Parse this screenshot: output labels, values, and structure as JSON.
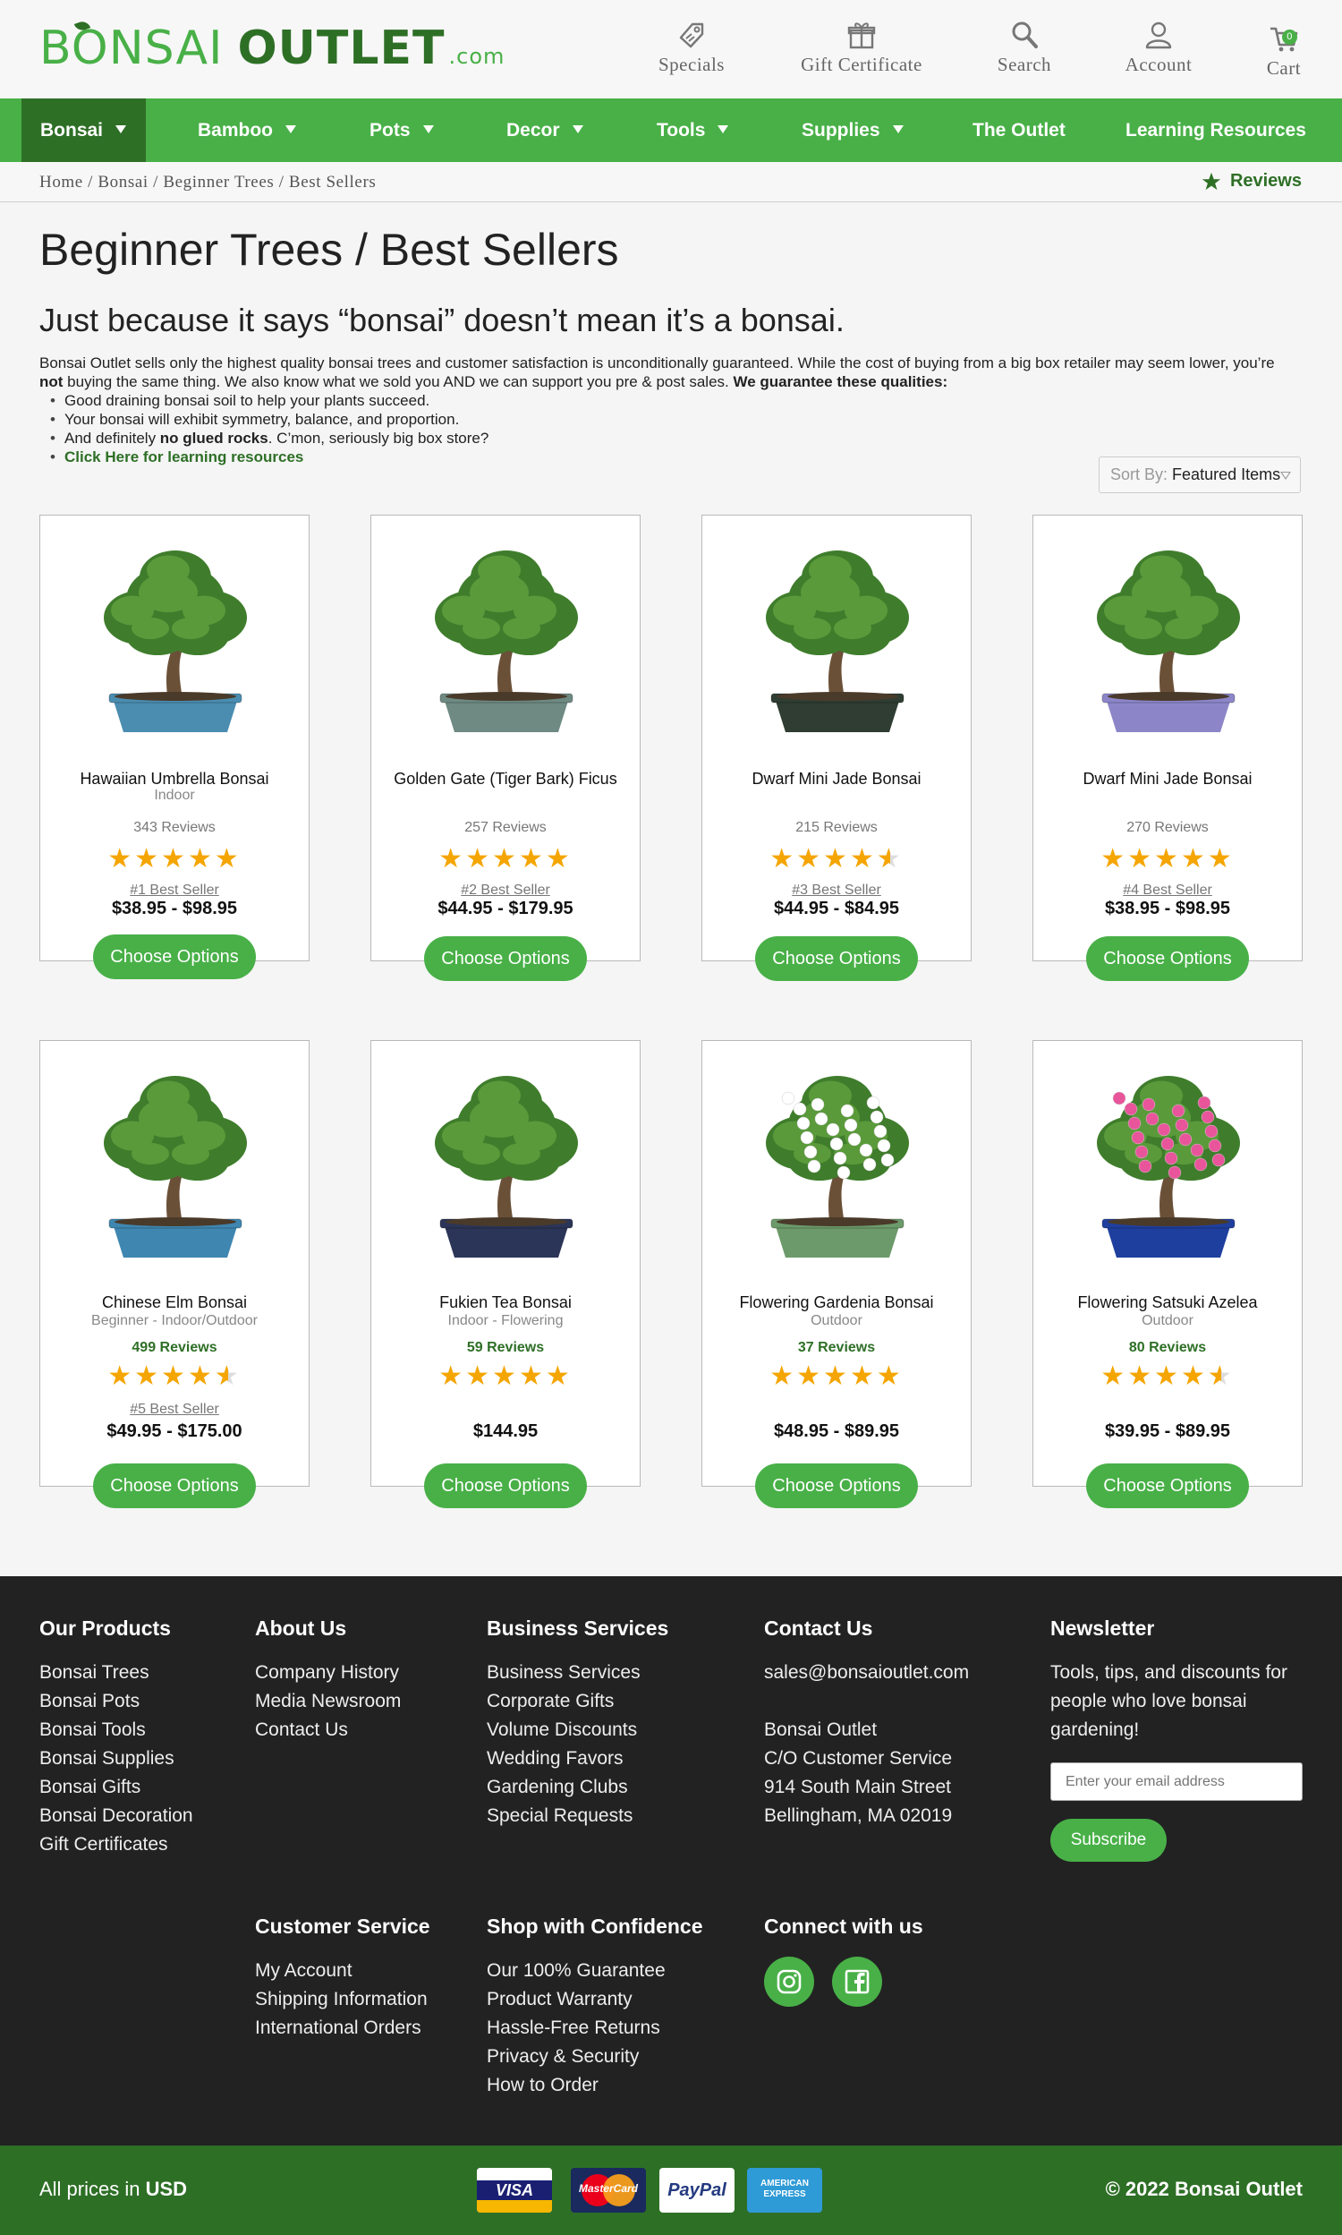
{
  "header": {
    "logo": {
      "word1": "BONSAI",
      "word2": "OUTLET",
      "suffix": ".com"
    },
    "icons": [
      {
        "label": "Specials",
        "icon": "tag-icon"
      },
      {
        "label": "Gift Certificate",
        "icon": "gift-icon"
      },
      {
        "label": "Search",
        "icon": "search-icon"
      },
      {
        "label": "Account",
        "icon": "user-icon"
      },
      {
        "label": "Cart",
        "icon": "cart-icon",
        "badge": "0"
      }
    ]
  },
  "nav": {
    "items": [
      {
        "label": "Bonsai",
        "dropdown": true,
        "active": true
      },
      {
        "label": "Bamboo",
        "dropdown": true
      },
      {
        "label": "Pots",
        "dropdown": true
      },
      {
        "label": "Decor",
        "dropdown": true
      },
      {
        "label": "Tools",
        "dropdown": true
      },
      {
        "label": "Supplies",
        "dropdown": true
      },
      {
        "label": "The Outlet",
        "dropdown": false
      },
      {
        "label": "Learning Resources",
        "dropdown": false
      }
    ]
  },
  "breadcrumb": {
    "text": "Home / Bonsai / Beginner Trees / Best Sellers",
    "reviews_label": "Reviews"
  },
  "main": {
    "title": "Beginner Trees / Best Sellers",
    "tagline": "Just because it says “bonsai” doesn’t mean it’s a bonsai.",
    "intro_1": "Bonsai Outlet sells only the highest quality bonsai trees and customer satisfaction is unconditionally guaranteed. While the cost of buying from a big box retailer may seem lower, you’re ",
    "intro_not": "not",
    "intro_2": " buying the same thing. We also know what we sold you AND we can support you pre & post sales. ",
    "intro_bold": "We guarantee these qualities:",
    "bullet_1": "Good draining bonsai soil to help your plants succeed.",
    "bullet_2": "Your bonsai will exhibit symmetry, balance, and proportion.",
    "bullet_3a": "And definitely ",
    "bullet_3b": "no glued rocks",
    "bullet_3c": ". C’mon, seriously big box store?",
    "bullet_4": "Click Here for learning resources",
    "sort_label": "Sort By:",
    "sort_value": "Featured Items"
  },
  "products": [
    {
      "name": "Hawaiian Umbrella Bonsai",
      "sub": "Indoor",
      "reviews": "343 Reviews",
      "rating": 5,
      "rank": "#1 Best Seller",
      "price": "$38.95 - $98.95",
      "button": "Choose Options",
      "pot_color": "#4a8db0",
      "flower": ""
    },
    {
      "name": "Golden Gate (Tiger Bark) Ficus",
      "sub": "",
      "reviews": "257 Reviews",
      "rating": 5,
      "rank": "#2 Best Seller",
      "price": "$44.95 - $179.95",
      "button": "Choose Options",
      "pot_color": "#6e8a82",
      "flower": ""
    },
    {
      "name": "Dwarf Mini Jade Bonsai",
      "sub": "",
      "reviews": "215 Reviews",
      "rating": 4.5,
      "rank": "#3 Best Seller",
      "price": "$44.95 - $84.95",
      "button": "Choose Options",
      "pot_color": "#2f3d33",
      "flower": ""
    },
    {
      "name": "Dwarf Mini Jade Bonsai",
      "sub": "",
      "reviews": "270 Reviews",
      "rating": 5,
      "rank": "#4 Best Seller",
      "price": "$38.95 - $98.95",
      "button": "Choose Options",
      "pot_color": "#8c86c9",
      "flower": ""
    },
    {
      "name": "Chinese Elm Bonsai",
      "sub": "Beginner - Indoor/Outdoor",
      "reviews": "499 Reviews",
      "rating": 4.5,
      "rank": "#5 Best Seller",
      "price": "$49.95 - $175.00",
      "button": "Choose Options",
      "pot_color": "#3f86b0",
      "flower": ""
    },
    {
      "name": "Fukien Tea Bonsai",
      "sub": "Indoor - Flowering",
      "reviews": "59 Reviews",
      "rating": 5,
      "rank": "",
      "price": "$144.95",
      "button": "Choose Options",
      "pot_color": "#2b3557",
      "flower": ""
    },
    {
      "name": "Flowering Gardenia Bonsai",
      "sub": "Outdoor",
      "reviews": "37 Reviews",
      "rating": 5,
      "rank": "",
      "price": "$48.95 - $89.95",
      "button": "Choose Options",
      "pot_color": "#6c9a6a",
      "flower": "#ffffff"
    },
    {
      "name": "Flowering Satsuki Azelea",
      "sub": "Outdoor",
      "reviews": "80 Reviews",
      "rating": 4.5,
      "rank": "",
      "price": "$39.95 - $89.95",
      "button": "Choose Options",
      "pot_color": "#1f3f9e",
      "flower": "#e8559a"
    }
  ],
  "footer": {
    "products": {
      "title": "Our Products",
      "links": [
        "Bonsai Trees",
        "Bonsai Pots",
        "Bonsai Tools",
        "Bonsai Supplies",
        "Bonsai Gifts",
        "Bonsai Decoration",
        "Gift Certificates"
      ]
    },
    "about": {
      "title": "About Us",
      "links": [
        "Company History",
        "Media Newsroom",
        "Contact Us"
      ]
    },
    "business": {
      "title": "Business Services",
      "links": [
        "Business Services",
        "Corporate Gifts",
        "Volume Discounts",
        "Wedding Favors",
        "Gardening Clubs",
        "Special Requests"
      ]
    },
    "contact": {
      "title": "Contact Us",
      "email": "sales@bonsaioutlet.com",
      "address": [
        "Bonsai Outlet",
        "C/O Customer Service",
        "914 South Main Street",
        "Bellingham, MA 02019"
      ]
    },
    "newsletter": {
      "title": "Newsletter",
      "text": "Tools, tips, and discounts for people who love bonsai gardening!",
      "placeholder": "Enter your email address",
      "button": "Subscribe"
    },
    "service": {
      "title": "Customer Service",
      "links": [
        "My Account",
        "Shipping Information",
        "International Orders"
      ]
    },
    "confidence": {
      "title": "Shop with Confidence",
      "links": [
        "Our 100% Guarantee",
        "Product Warranty",
        "Hassle-Free Returns",
        "Privacy & Security",
        "How to Order"
      ]
    },
    "connect": {
      "title": "Connect with us",
      "icons": [
        "instagram-icon",
        "facebook-icon"
      ]
    }
  },
  "bottombar": {
    "prices_prefix": "All prices in ",
    "currency": "USD",
    "payments": [
      "VISA",
      "MasterCard",
      "PayPal",
      "AMERICAN EXPRESS"
    ],
    "copyright": "© 2022 Bonsai Outlet"
  },
  "colors": {
    "brand_green": "#48b047",
    "dark_green": "#2e6f26",
    "star": "#f5a500",
    "footer_bg": "#222222"
  }
}
